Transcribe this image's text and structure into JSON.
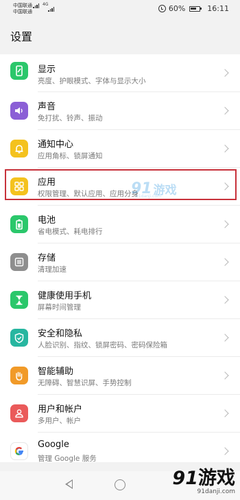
{
  "status_bar": {
    "carrier1": "中国联通",
    "carrier2": "中国联通",
    "net_label": "4G",
    "battery": "60%",
    "time": "16:11"
  },
  "page": {
    "title": "设置"
  },
  "items": [
    {
      "title": "显示",
      "subtitle": "亮度、护眼模式、字体与显示大小",
      "icon": "display-icon",
      "color": "#2bc76b"
    },
    {
      "title": "声音",
      "subtitle": "免打扰、铃声、振动",
      "icon": "sound-icon",
      "color": "#8b5fd6"
    },
    {
      "title": "通知中心",
      "subtitle": "应用角标、锁屏通知",
      "icon": "bell-icon",
      "color": "#f4c21e"
    },
    {
      "title": "应用",
      "subtitle": "权限管理、默认应用、应用分身",
      "icon": "apps-icon",
      "color": "#f4c21e"
    },
    {
      "title": "电池",
      "subtitle": "省电模式、耗电排行",
      "icon": "battery-icon",
      "color": "#2bc76b"
    },
    {
      "title": "存储",
      "subtitle": "清理加速",
      "icon": "storage-icon",
      "color": "#8e8e8e"
    },
    {
      "title": "健康使用手机",
      "subtitle": "屏幕时间管理",
      "icon": "hourglass-icon",
      "color": "#2bc76b"
    },
    {
      "title": "安全和隐私",
      "subtitle": "人脸识别、指纹、锁屏密码、密码保险箱",
      "icon": "shield-icon",
      "color": "#27b6a0"
    },
    {
      "title": "智能辅助",
      "subtitle": "无障碍、智慧识屏、手势控制",
      "icon": "hand-icon",
      "color": "#f19a28"
    },
    {
      "title": "用户和帐户",
      "subtitle": "多用户、帐户",
      "icon": "user-icon",
      "color": "#ea5a5a"
    },
    {
      "title": "Google",
      "subtitle": "管理 Google 服务",
      "icon": "google-icon",
      "color": "#ffffff"
    }
  ],
  "watermark": {
    "logo_number": "91",
    "logo_text": "游戏",
    "url": "91danji.com",
    "center_url": "91danji.com"
  }
}
